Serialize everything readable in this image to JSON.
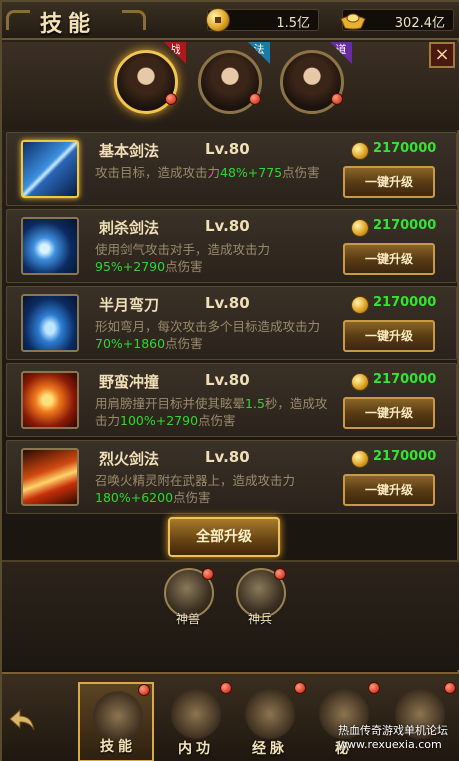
{
  "header": {
    "title": "技能",
    "coins": "1.5亿",
    "ingots": "302.4亿"
  },
  "heroes": [
    {
      "tag": "战",
      "tag_color": "#b0171b"
    },
    {
      "tag": "法",
      "tag_color": "#1c7aa8"
    },
    {
      "tag": "道",
      "tag_color": "#6a2aa0"
    }
  ],
  "close_icon": "×",
  "skills": [
    {
      "name": "基本剑法",
      "level": "Lv.80",
      "desc_plain": "攻击目标，造成攻击力",
      "desc_green": "48%+775",
      "desc_tail": "点伤害",
      "cost": "2170000",
      "button": "一键升级",
      "icon": "sword-slash-icon"
    },
    {
      "name": "刺杀剑法",
      "level": "Lv.80",
      "desc_plain": "使用剑气攻击对手，造成攻击力",
      "desc_green": "95%+2790",
      "desc_tail": "点伤害",
      "cost": "2170000",
      "button": "一键升级",
      "icon": "sword-qi-icon"
    },
    {
      "name": "半月弯刀",
      "level": "Lv.80",
      "desc_plain": "形如弯月，每次攻击多个目标造成攻击力",
      "desc_green": "70%+1860",
      "desc_tail": "点伤害",
      "cost": "2170000",
      "button": "一键升级",
      "icon": "crescent-blade-icon"
    },
    {
      "name": "野蛮冲撞",
      "level": "Lv.80",
      "desc_plain": "用肩膀撞开目标并使其眩晕",
      "desc_green_a": "1.5",
      "desc_mid": "秒，造成攻击力",
      "desc_green": "100%+2790",
      "desc_tail": "点伤害",
      "cost": "2170000",
      "button": "一键升级",
      "icon": "charge-icon"
    },
    {
      "name": "烈火剑法",
      "level": "Lv.80",
      "desc_plain": "召唤火精灵附在武器上，造成攻击力",
      "desc_green": "180%+6200",
      "desc_tail": "点伤害",
      "cost": "2170000",
      "button": "一键升级",
      "icon": "flame-sword-icon"
    }
  ],
  "upgrade_all": "全部升级",
  "side_buttons": [
    {
      "label": "神兽"
    },
    {
      "label": "神兵"
    }
  ],
  "tabs": [
    {
      "label": "技能",
      "selected": true
    },
    {
      "label": "内功",
      "selected": false
    },
    {
      "label": "经脉",
      "selected": false
    },
    {
      "label": "秘",
      "selected": false
    }
  ],
  "watermark": {
    "line1": "热血传奇游戏单机论坛",
    "line2": "www.rexuexia.com"
  }
}
